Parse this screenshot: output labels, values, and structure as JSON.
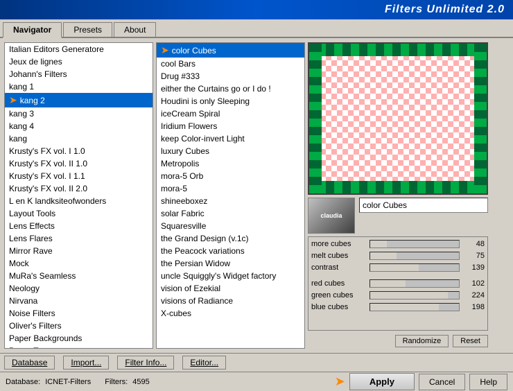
{
  "titleBar": {
    "text": "Filters Unlimited 2.0"
  },
  "tabs": [
    {
      "label": "Navigator",
      "active": true
    },
    {
      "label": "Presets",
      "active": false
    },
    {
      "label": "About",
      "active": false
    }
  ],
  "leftList": {
    "items": [
      {
        "label": "Italian Editors Generatore",
        "selected": false
      },
      {
        "label": "Jeux de lignes",
        "selected": false
      },
      {
        "label": "Johann's Filters",
        "selected": false
      },
      {
        "label": "kang 1",
        "selected": false
      },
      {
        "label": "kang 2",
        "selected": true,
        "arrow": true
      },
      {
        "label": "kang 3",
        "selected": false
      },
      {
        "label": "kang 4",
        "selected": false
      },
      {
        "label": "kang",
        "selected": false
      },
      {
        "label": "Krusty's FX vol. I 1.0",
        "selected": false
      },
      {
        "label": "Krusty's FX vol. II 1.0",
        "selected": false
      },
      {
        "label": "Krusty's FX vol. I 1.1",
        "selected": false
      },
      {
        "label": "Krusty's FX vol. II 2.0",
        "selected": false
      },
      {
        "label": "L en K landksiteofwonders",
        "selected": false
      },
      {
        "label": "Layout Tools",
        "selected": false
      },
      {
        "label": "Lens Effects",
        "selected": false
      },
      {
        "label": "Lens Flares",
        "selected": false
      },
      {
        "label": "Mirror Rave",
        "selected": false
      },
      {
        "label": "Mock",
        "selected": false
      },
      {
        "label": "MuRa's Seamless",
        "selected": false
      },
      {
        "label": "Neology",
        "selected": false
      },
      {
        "label": "Nirvana",
        "selected": false
      },
      {
        "label": "Noise Filters",
        "selected": false
      },
      {
        "label": "Oliver's Filters",
        "selected": false
      },
      {
        "label": "Paper Backgrounds",
        "selected": false
      },
      {
        "label": "Paper Textures",
        "selected": false
      }
    ]
  },
  "middleList": {
    "items": [
      {
        "label": "color Cubes",
        "selected": true,
        "arrow": true
      },
      {
        "label": "cool Bars",
        "selected": false
      },
      {
        "label": "Drug #333",
        "selected": false
      },
      {
        "label": "either the Curtains go or I do !",
        "selected": false
      },
      {
        "label": "Houdini is only Sleeping",
        "selected": false
      },
      {
        "label": "iceCream Spiral",
        "selected": false
      },
      {
        "label": "Iridium Flowers",
        "selected": false
      },
      {
        "label": "keep Color-invert Light",
        "selected": false
      },
      {
        "label": "luxury Cubes",
        "selected": false
      },
      {
        "label": "Metropolis",
        "selected": false
      },
      {
        "label": "mora-5 Orb",
        "selected": false
      },
      {
        "label": "mora-5",
        "selected": false
      },
      {
        "label": "shineeboxez",
        "selected": false
      },
      {
        "label": "solar Fabric",
        "selected": false
      },
      {
        "label": "Squaresville",
        "selected": false
      },
      {
        "label": "the Grand Design    (v.1c)",
        "selected": false
      },
      {
        "label": "the Peacock variations",
        "selected": false
      },
      {
        "label": "the Persian Widow",
        "selected": false
      },
      {
        "label": "uncle Squiggly's Widget factory",
        "selected": false
      },
      {
        "label": "vision of Ezekial",
        "selected": false
      },
      {
        "label": "visions of Radiance",
        "selected": false
      },
      {
        "label": "X-cubes",
        "selected": false
      }
    ]
  },
  "filterName": "color Cubes",
  "thumbLabel": "claudia",
  "sliders": [
    {
      "label": "more cubes",
      "value": 48,
      "max": 255
    },
    {
      "label": "melt cubes",
      "value": 75,
      "max": 255
    },
    {
      "label": "contrast",
      "value": 139,
      "max": 255
    },
    {
      "label": "red cubes",
      "value": 102,
      "max": 255
    },
    {
      "label": "green cubes",
      "value": 224,
      "max": 255
    },
    {
      "label": "blue cubes",
      "value": 198,
      "max": 255
    }
  ],
  "buttons": {
    "randomize": "Randomize",
    "reset": "Reset",
    "apply": "Apply",
    "cancel": "Cancel",
    "help": "Help"
  },
  "bottomToolbar": {
    "database": "Database",
    "import": "Import...",
    "filterInfo": "Filter Info...",
    "editor": "Editor..."
  },
  "statusBar": {
    "databaseLabel": "Database:",
    "databaseValue": "ICNET-Filters",
    "filtersLabel": "Filters:",
    "filtersValue": "4595"
  }
}
